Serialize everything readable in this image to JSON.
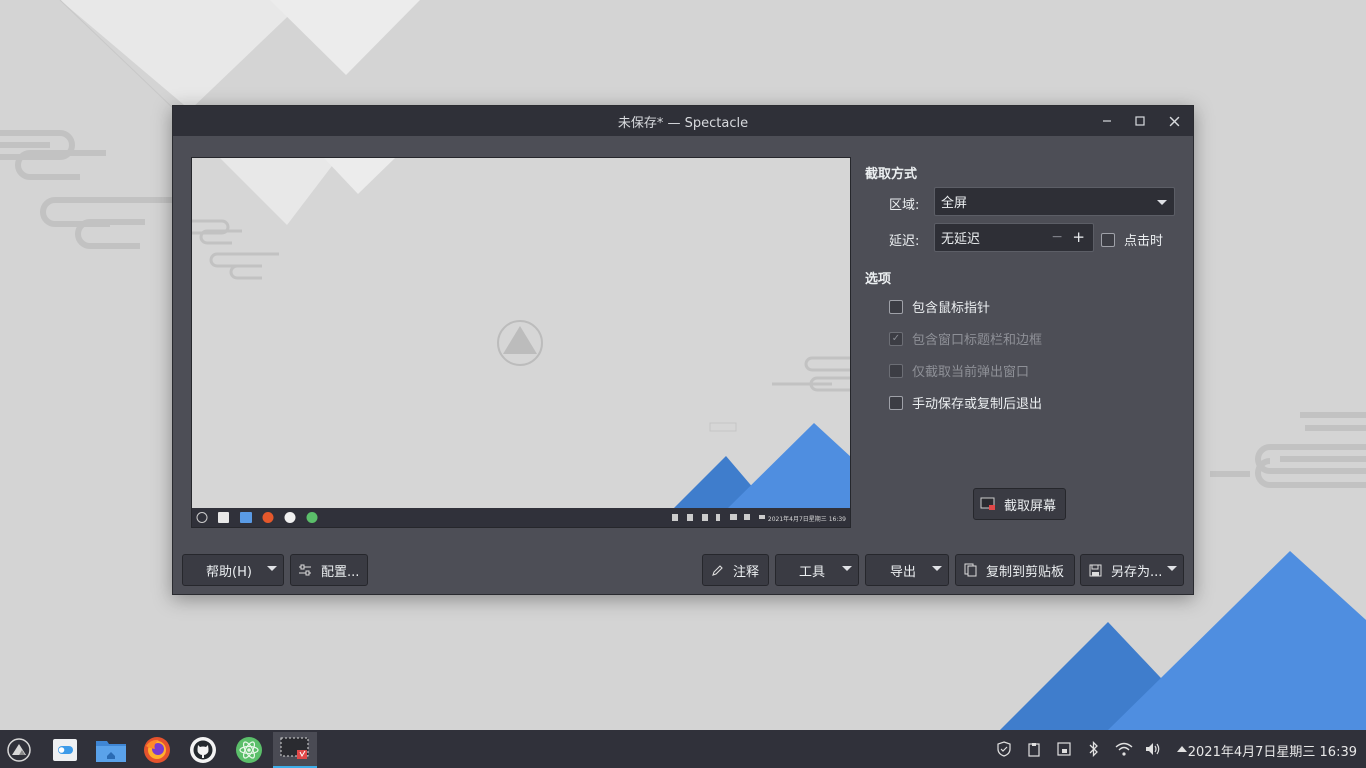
{
  "window": {
    "title": "未保存* — Spectacle"
  },
  "capture_mode": {
    "heading": "截取方式",
    "area_label": "区域:",
    "area_value": "全屏",
    "delay_label": "延迟:",
    "delay_value": "无延迟",
    "on_click_label": "点击时"
  },
  "options": {
    "heading": "选项",
    "items": [
      {
        "label": "包含鼠标指针",
        "checked": false,
        "enabled": true
      },
      {
        "label": "包含窗口标题栏和边框",
        "checked": true,
        "enabled": false
      },
      {
        "label": "仅截取当前弹出窗口",
        "checked": false,
        "enabled": false
      },
      {
        "label": "手动保存或复制后退出",
        "checked": false,
        "enabled": true
      }
    ]
  },
  "take_screenshot_label": "截取屏幕",
  "bottom_buttons": {
    "help": "帮助(H)",
    "configure": "配置...",
    "annotate": "注释",
    "tools": "工具",
    "export": "导出",
    "copy_clipboard": "复制到剪贴板",
    "save_as": "另存为..."
  },
  "preview_clock": "2021年4月7日星期三 16:39",
  "taskbar": {
    "apps": [
      "launcher-icon",
      "system-settings-icon",
      "file-manager-icon",
      "firefox-icon",
      "github-icon",
      "atom-icon",
      "spectacle-icon"
    ],
    "tray": [
      "shield-icon",
      "clipboard-icon",
      "device-icon",
      "bluetooth-icon",
      "wifi-icon",
      "volume-icon",
      "expand-tray-icon"
    ],
    "clock": "2021年4月7日星期三 16:39"
  },
  "colors": {
    "accent_blue": "#4f8ee0",
    "window_bg": "#4d4e56",
    "titlebar_bg": "#2f3038",
    "taskbar_bg": "#30313a"
  }
}
